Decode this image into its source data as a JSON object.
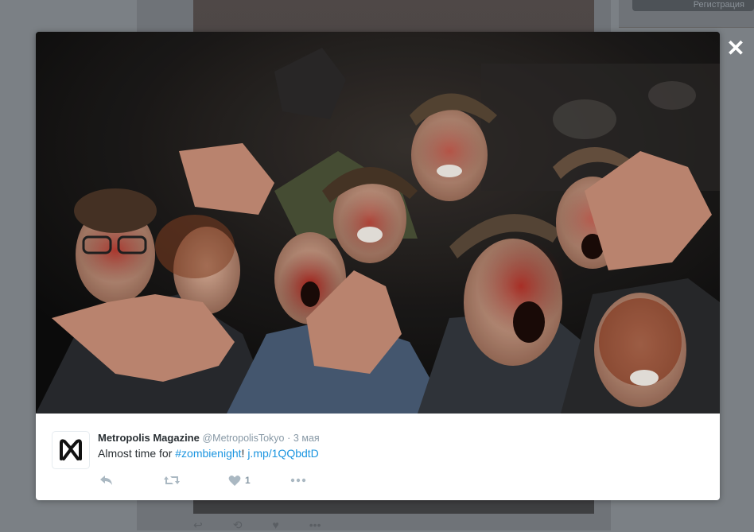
{
  "background": {
    "side_button_label": "Регистрация"
  },
  "modal": {
    "close_glyph": "✕",
    "media": {
      "description_icon": "photo"
    },
    "tweet": {
      "author_name": "Metropolis Magazine",
      "handle": "@MetropolisTokyo",
      "separator": "·",
      "date": "3 мая",
      "text_before": "Almost time for ",
      "hashtag": "#zombienight",
      "text_mid": "! ",
      "url": "j.mp/1QQbdtD",
      "like_count": "1"
    },
    "colors": {
      "link": "#1b95e0",
      "action_icon": "#aab8c2",
      "overlay": "#7b8085"
    },
    "icons": {
      "reply": "reply-icon",
      "retweet": "retweet-icon",
      "like": "heart-icon",
      "more": "more-icon",
      "avatar": "metropolis-logo-icon"
    }
  }
}
